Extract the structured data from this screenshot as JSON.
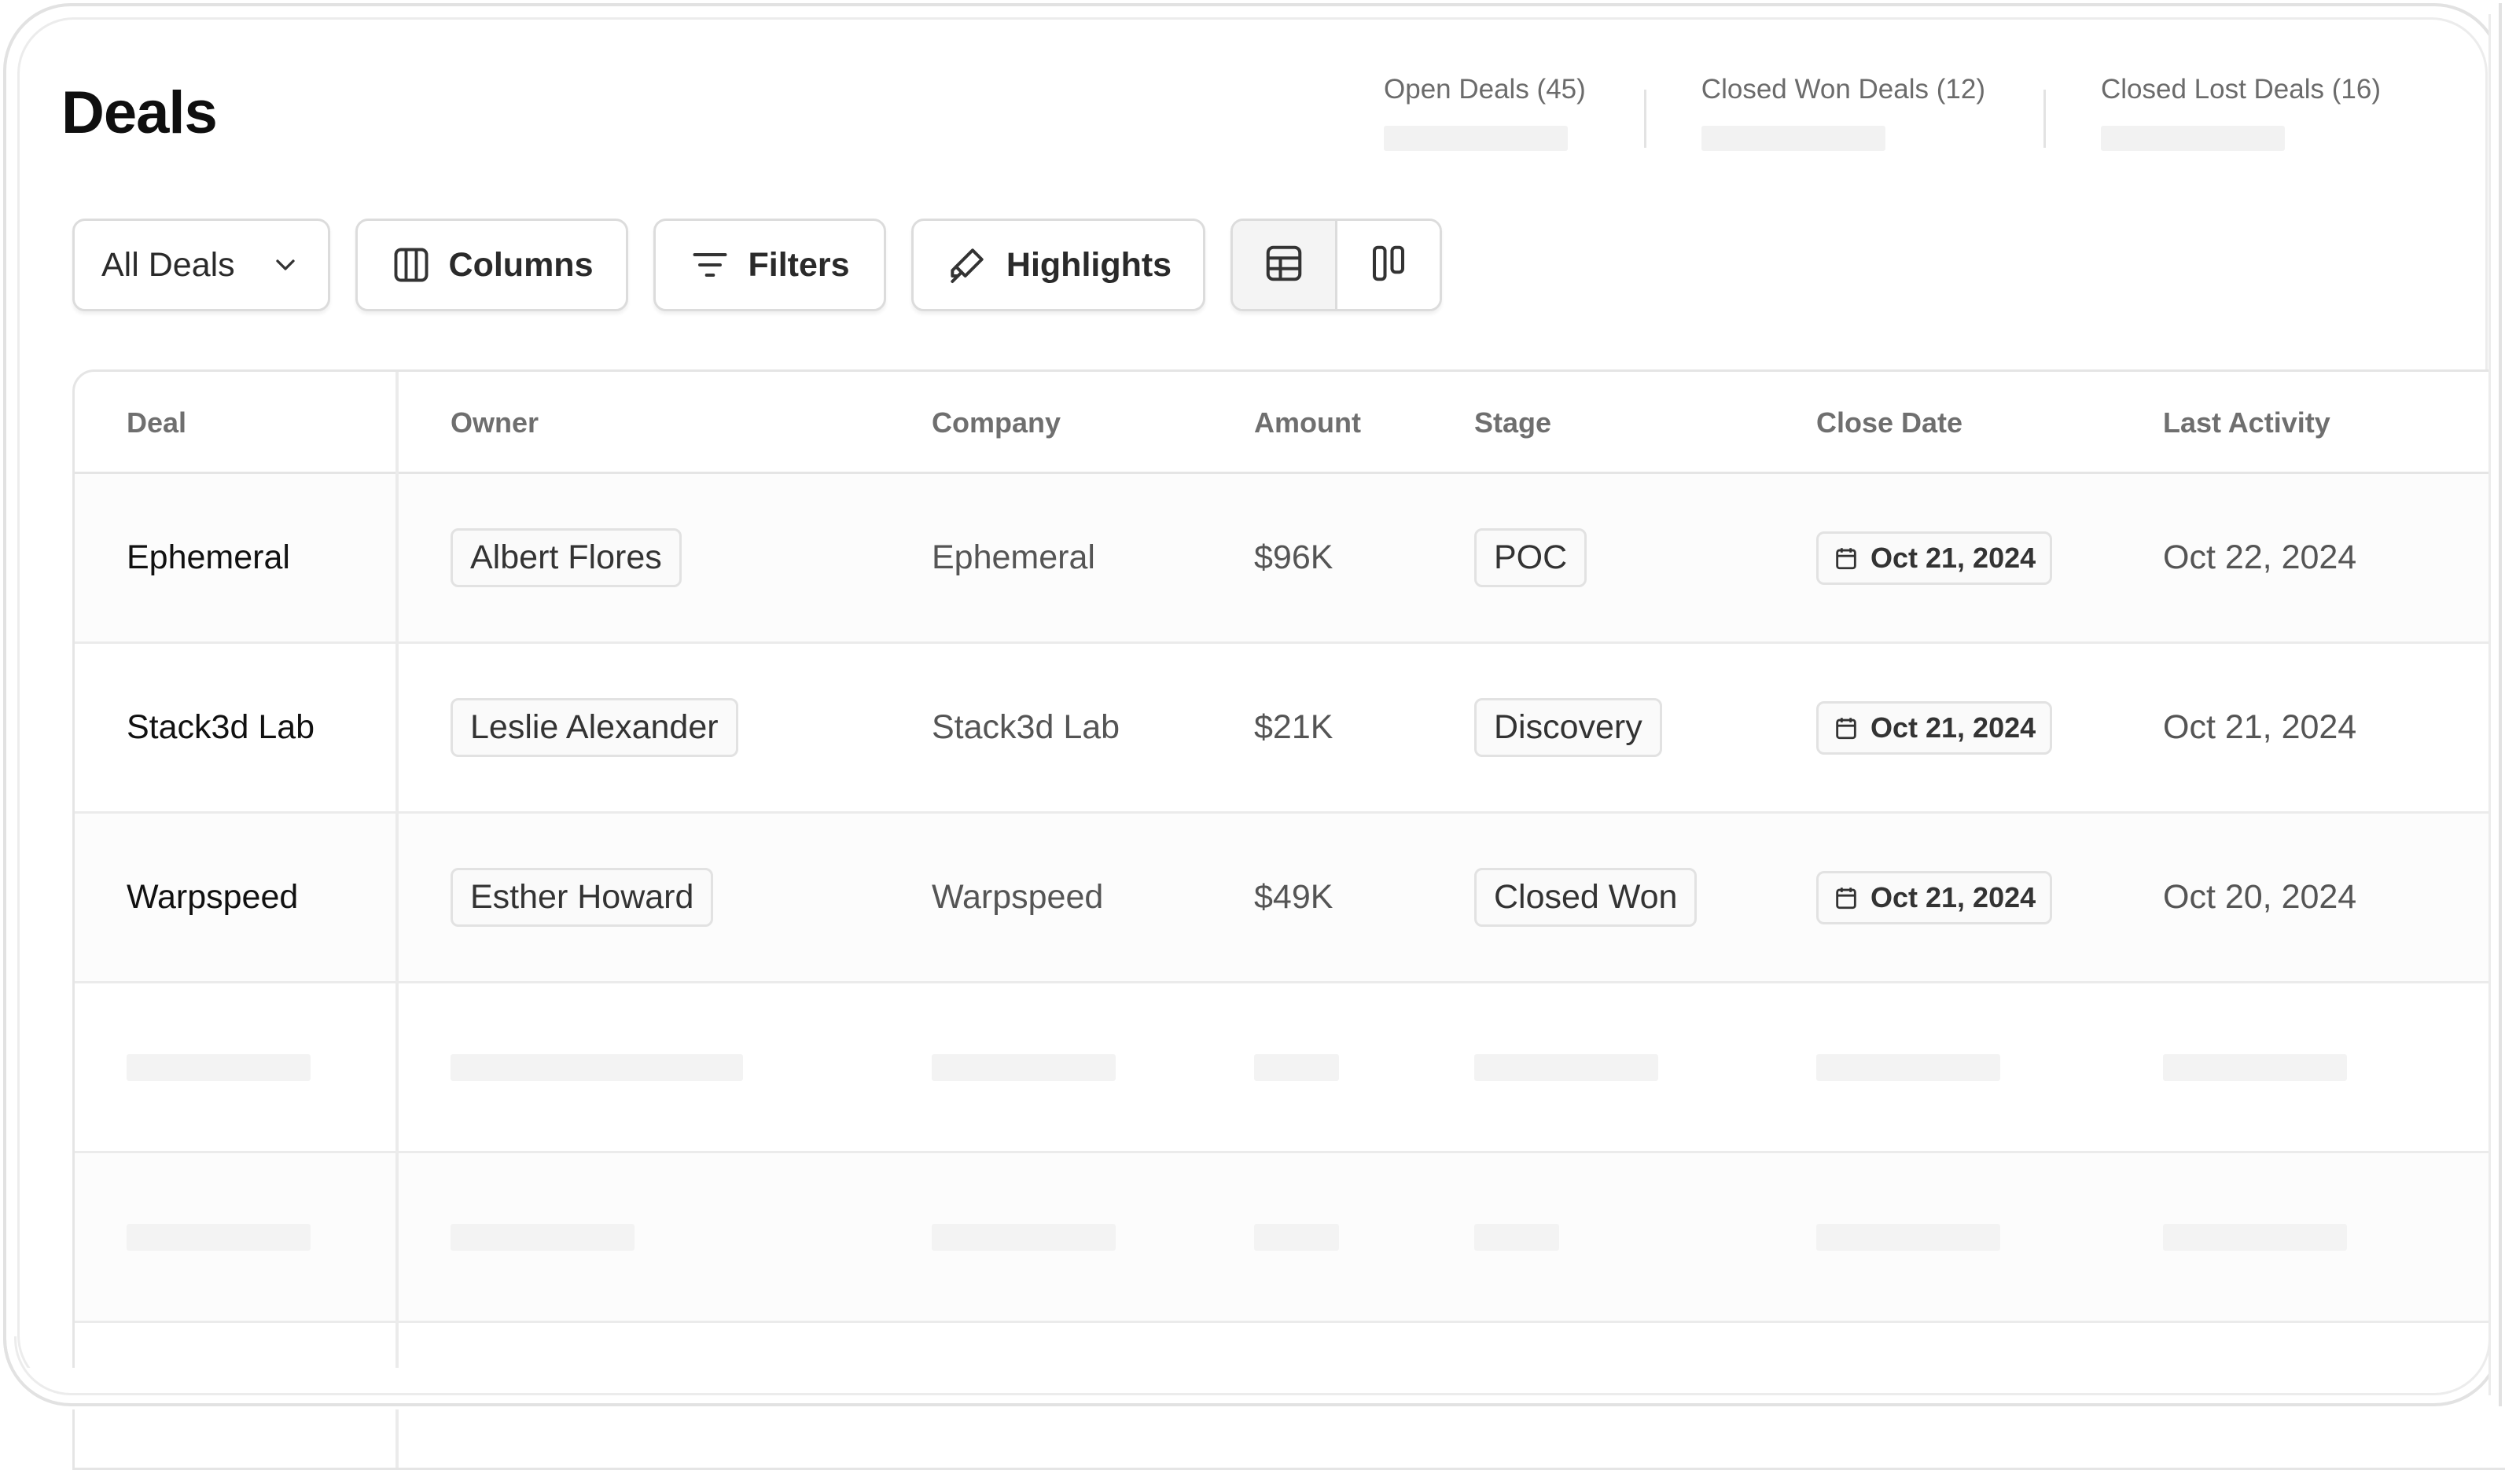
{
  "page": {
    "title": "Deals"
  },
  "stats": [
    {
      "label": "Open Deals (45)"
    },
    {
      "label": "Closed Won Deals (12)"
    },
    {
      "label": "Closed Lost Deals (16)"
    }
  ],
  "toolbar": {
    "view_select": "All Deals",
    "columns_label": "Columns",
    "filters_label": "Filters",
    "highlights_label": "Highlights",
    "view_modes": [
      {
        "icon": "table-view-icon",
        "active": true
      },
      {
        "icon": "kanban-view-icon",
        "active": false
      }
    ]
  },
  "table": {
    "columns": [
      "Deal",
      "Owner",
      "Company",
      "Amount",
      "Stage",
      "Close Date",
      "Last Activity"
    ],
    "rows": [
      {
        "deal": "Ephemeral",
        "owner": "Albert Flores",
        "company": "Ephemeral",
        "amount": "$96K",
        "stage": "POC",
        "close_date": "Oct 21, 2024",
        "last_activity": "Oct 22, 2024"
      },
      {
        "deal": "Stack3d Lab",
        "owner": "Leslie Alexander",
        "company": "Stack3d Lab",
        "amount": "$21K",
        "stage": "Discovery",
        "close_date": "Oct 21, 2024",
        "last_activity": "Oct 21, 2024"
      },
      {
        "deal": "Warpspeed",
        "owner": "Esther Howard",
        "company": "Warpspeed",
        "amount": "$49K",
        "stage": "Closed Won",
        "close_date": "Oct 21, 2024",
        "last_activity": "Oct 20, 2024"
      }
    ]
  },
  "colors": {
    "border": "#e5e5e5",
    "muted_text": "#6f6f6f",
    "skeleton": "#f3f3f3"
  }
}
